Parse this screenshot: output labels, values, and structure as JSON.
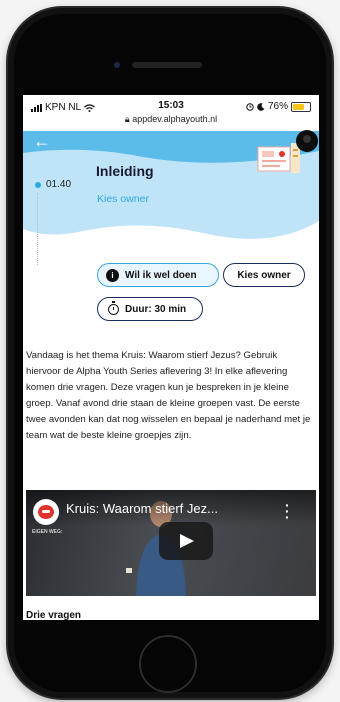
{
  "status_bar": {
    "carrier": "KPN NL",
    "time": "15:03",
    "battery": "76%",
    "url": "appdev.alphayouth.nl"
  },
  "header": {
    "back_icon": "arrow-left-icon",
    "title": "Inleiding",
    "subtitle": "Kies owner",
    "timecode": "01.40",
    "accent_color": "#bfe4f8"
  },
  "tags": {
    "first": "Wil ik wel doen",
    "second": "Kies owner",
    "duration": "Duur: 30 min"
  },
  "body": {
    "paragraph": "Vandaag is het thema Kruis: Waarom stierf Jezus? Gebruik hiervoor de Alpha Youth Series aflevering 3! In elke aflevering komen drie vragen. Deze vragen kun je bespreken in je kleine groep. Vanaf avond drie staan de kleine groepen vast. De eerste twee avonden kan dat nog wisselen en bepaal je naderhand met je team wat de beste kleine groepjes zijn."
  },
  "video": {
    "title": "Kruis: Waarom stierf Jez...",
    "overlay": "EIGEN WEG:"
  },
  "next_section": {
    "heading": "Drie vragen"
  },
  "colors": {
    "accent": "#2ea8e0",
    "pill_border": "#1b2e5a",
    "youtube_red": "#e0332c"
  }
}
